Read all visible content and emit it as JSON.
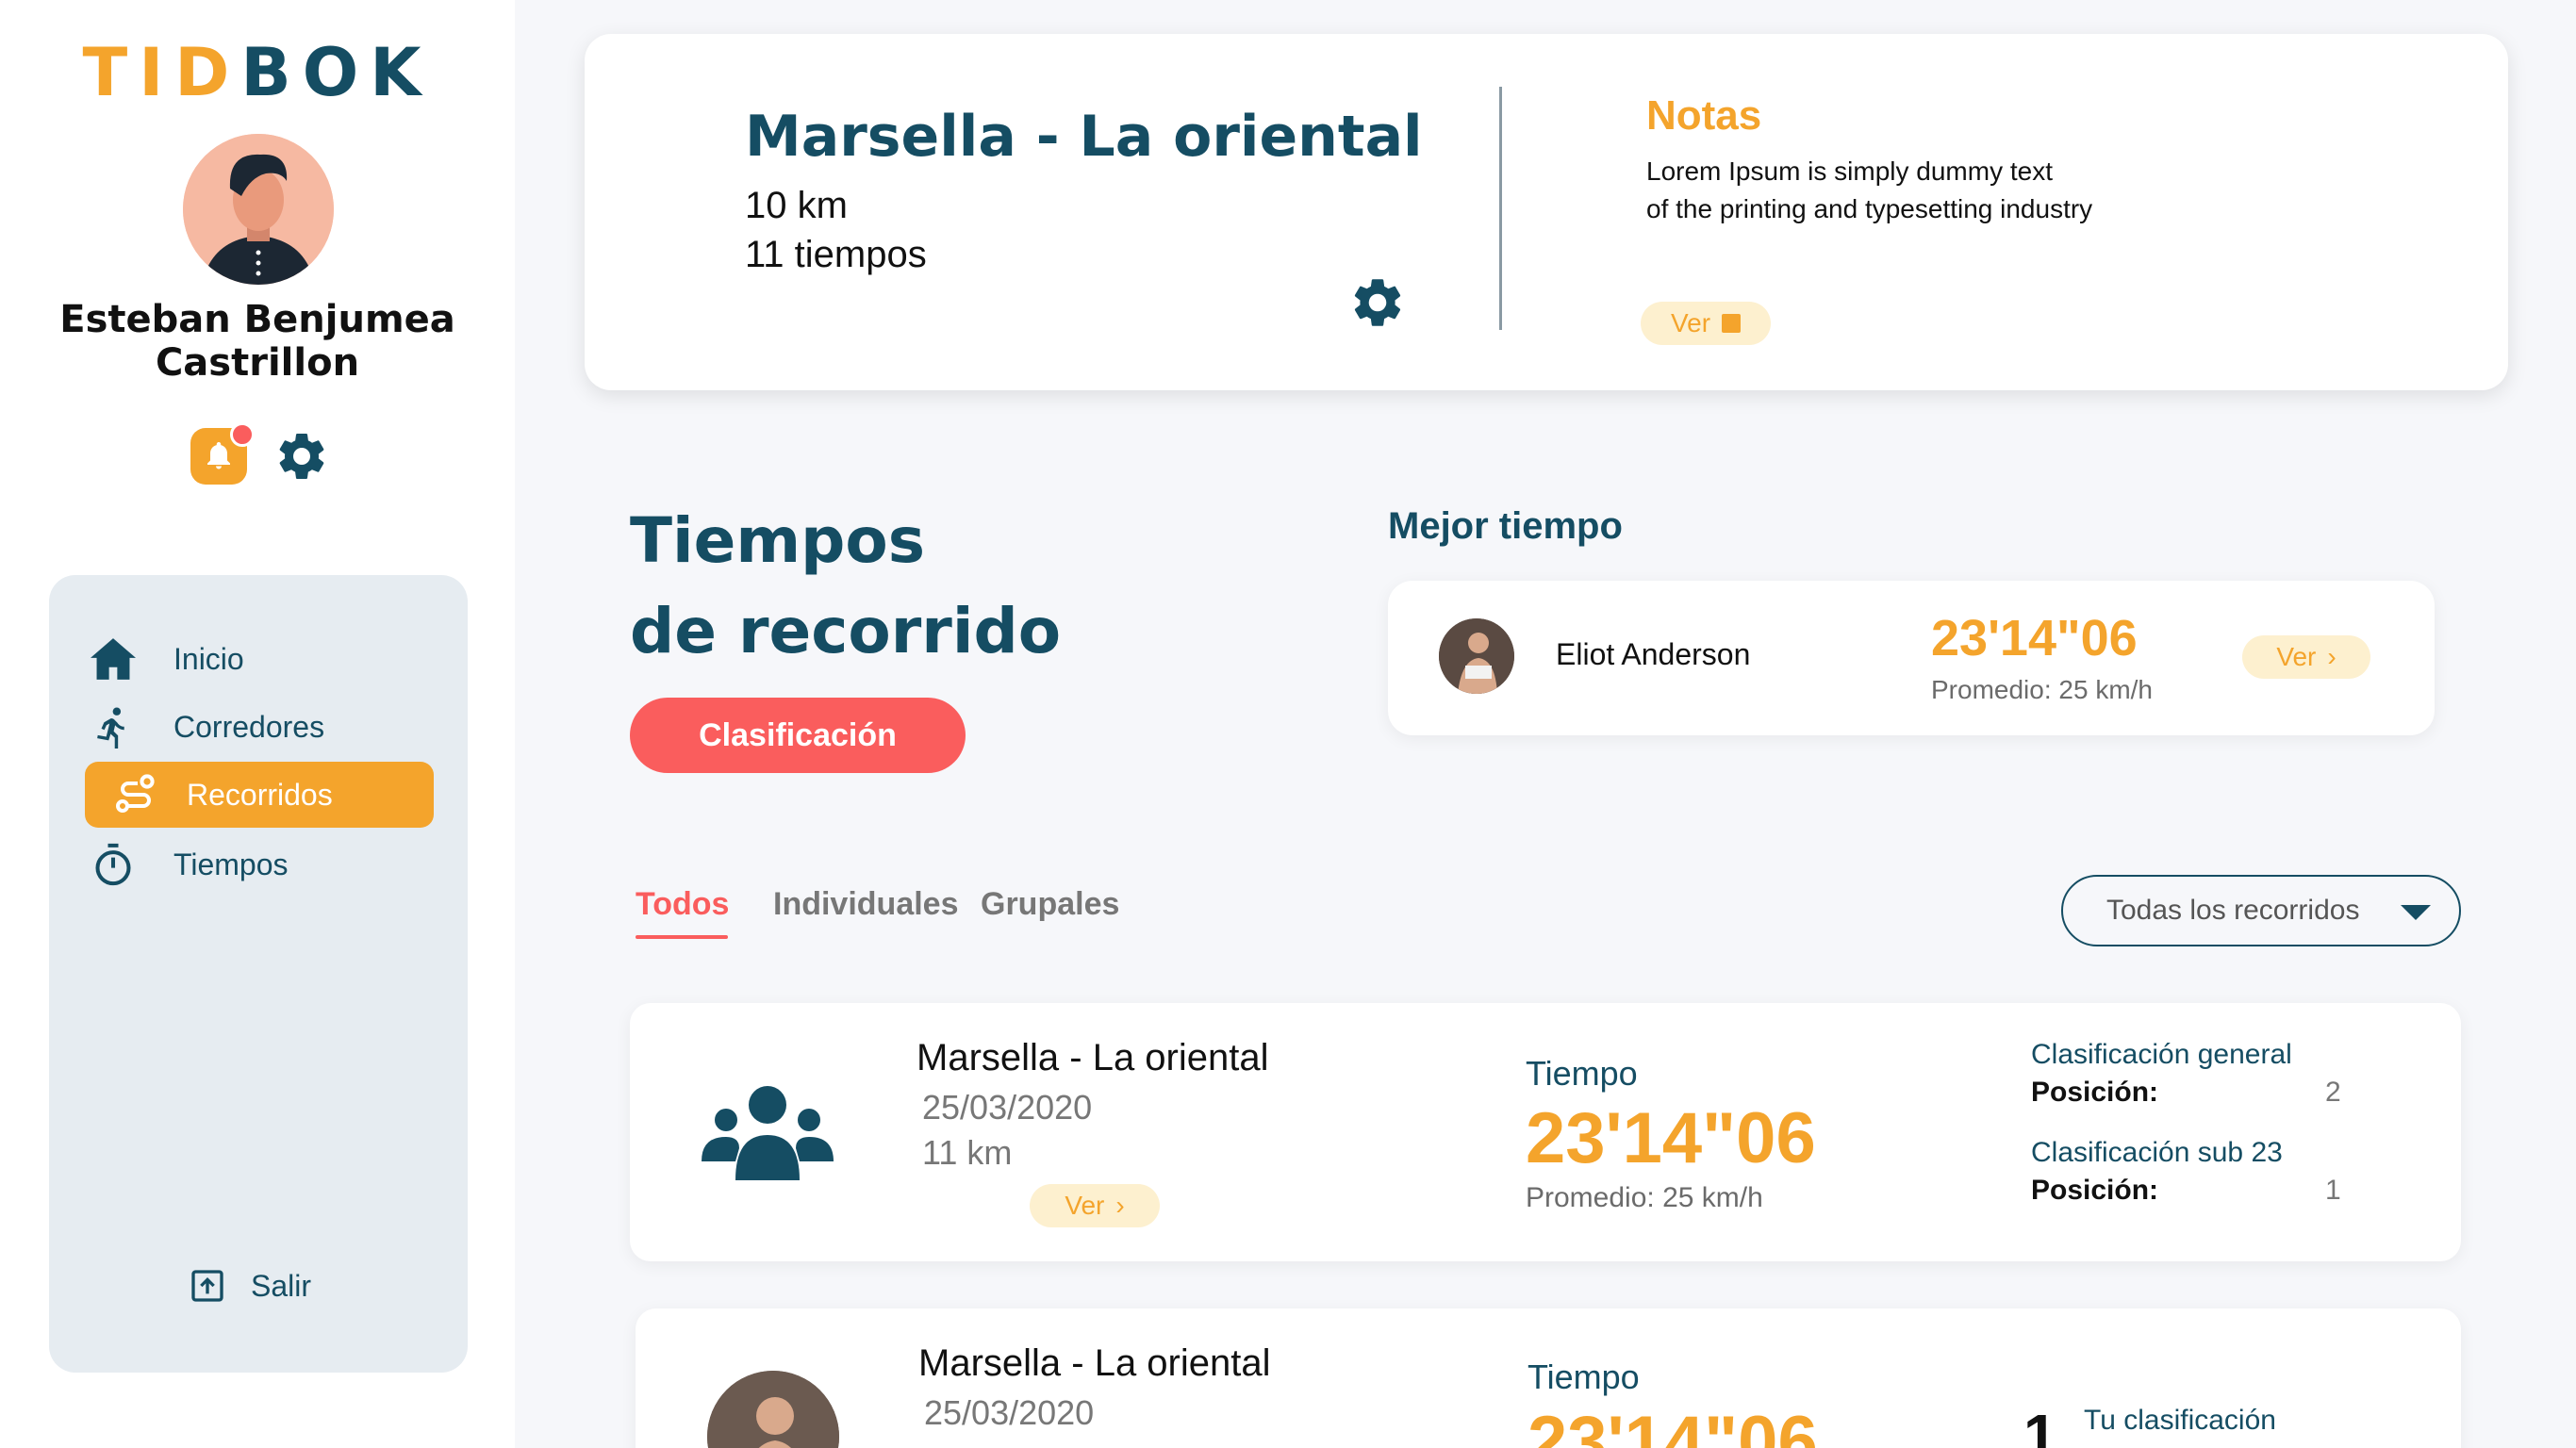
{
  "brand": {
    "part1": "TID",
    "part2": "BOK",
    "color_primary": "#154d63",
    "color_accent": "#f4a42c",
    "color_alert": "#fa5d5d"
  },
  "user": {
    "name_line1": "Esteban Benjumea",
    "name_line2": "Castrillon",
    "notifications": "bell-icon",
    "settings": "gear-icon"
  },
  "nav": {
    "items": [
      {
        "label": "Inicio",
        "icon": "home-icon",
        "active": false
      },
      {
        "label": "Corredores",
        "icon": "runner-icon",
        "active": false
      },
      {
        "label": "Recorridos",
        "icon": "route-icon",
        "active": true
      },
      {
        "label": "Tiempos",
        "icon": "stopwatch-icon",
        "active": false
      }
    ],
    "logout": "Salir"
  },
  "route": {
    "title": "Marsella - La oriental",
    "distance": "10 km",
    "times_count": "11 tiempos",
    "notes_title": "Notas",
    "notes_line1": "Lorem Ipsum is simply dummy text",
    "notes_line2": "of the printing and typesetting industry",
    "notes_button": "Ver"
  },
  "section": {
    "title_line1": "Tiempos",
    "title_line2": "de recorrido",
    "classification_button": "Clasificación"
  },
  "best": {
    "label": "Mejor tiempo",
    "name": "Eliot Anderson",
    "time": "23'14\"06",
    "avg": "Promedio: 25 km/h",
    "button": "Ver"
  },
  "tabs": {
    "all": "Todos",
    "individual": "Individuales",
    "group": "Grupales",
    "active": "Todos"
  },
  "filter": {
    "selected": "Todas los recorridos"
  },
  "records": [
    {
      "title": "Marsella - La oriental",
      "date": "25/03/2020",
      "distance": "11 km",
      "button": "Ver",
      "time_label": "Tiempo",
      "time": "23'14\"06",
      "avg": "Promedio: 25 km/h",
      "cls1_title": "Clasificación general",
      "cls1_pos_label": "Posición:",
      "cls1_pos": "2",
      "cls2_title": "Clasificación sub 23",
      "cls2_pos_label": "Posición:",
      "cls2_pos": "1"
    },
    {
      "title": "Marsella - La oriental",
      "date": "25/03/2020",
      "time_label": "Tiempo",
      "time": "23'14\"06",
      "rank": "1",
      "rank_label": "Tu clasificación"
    }
  ]
}
